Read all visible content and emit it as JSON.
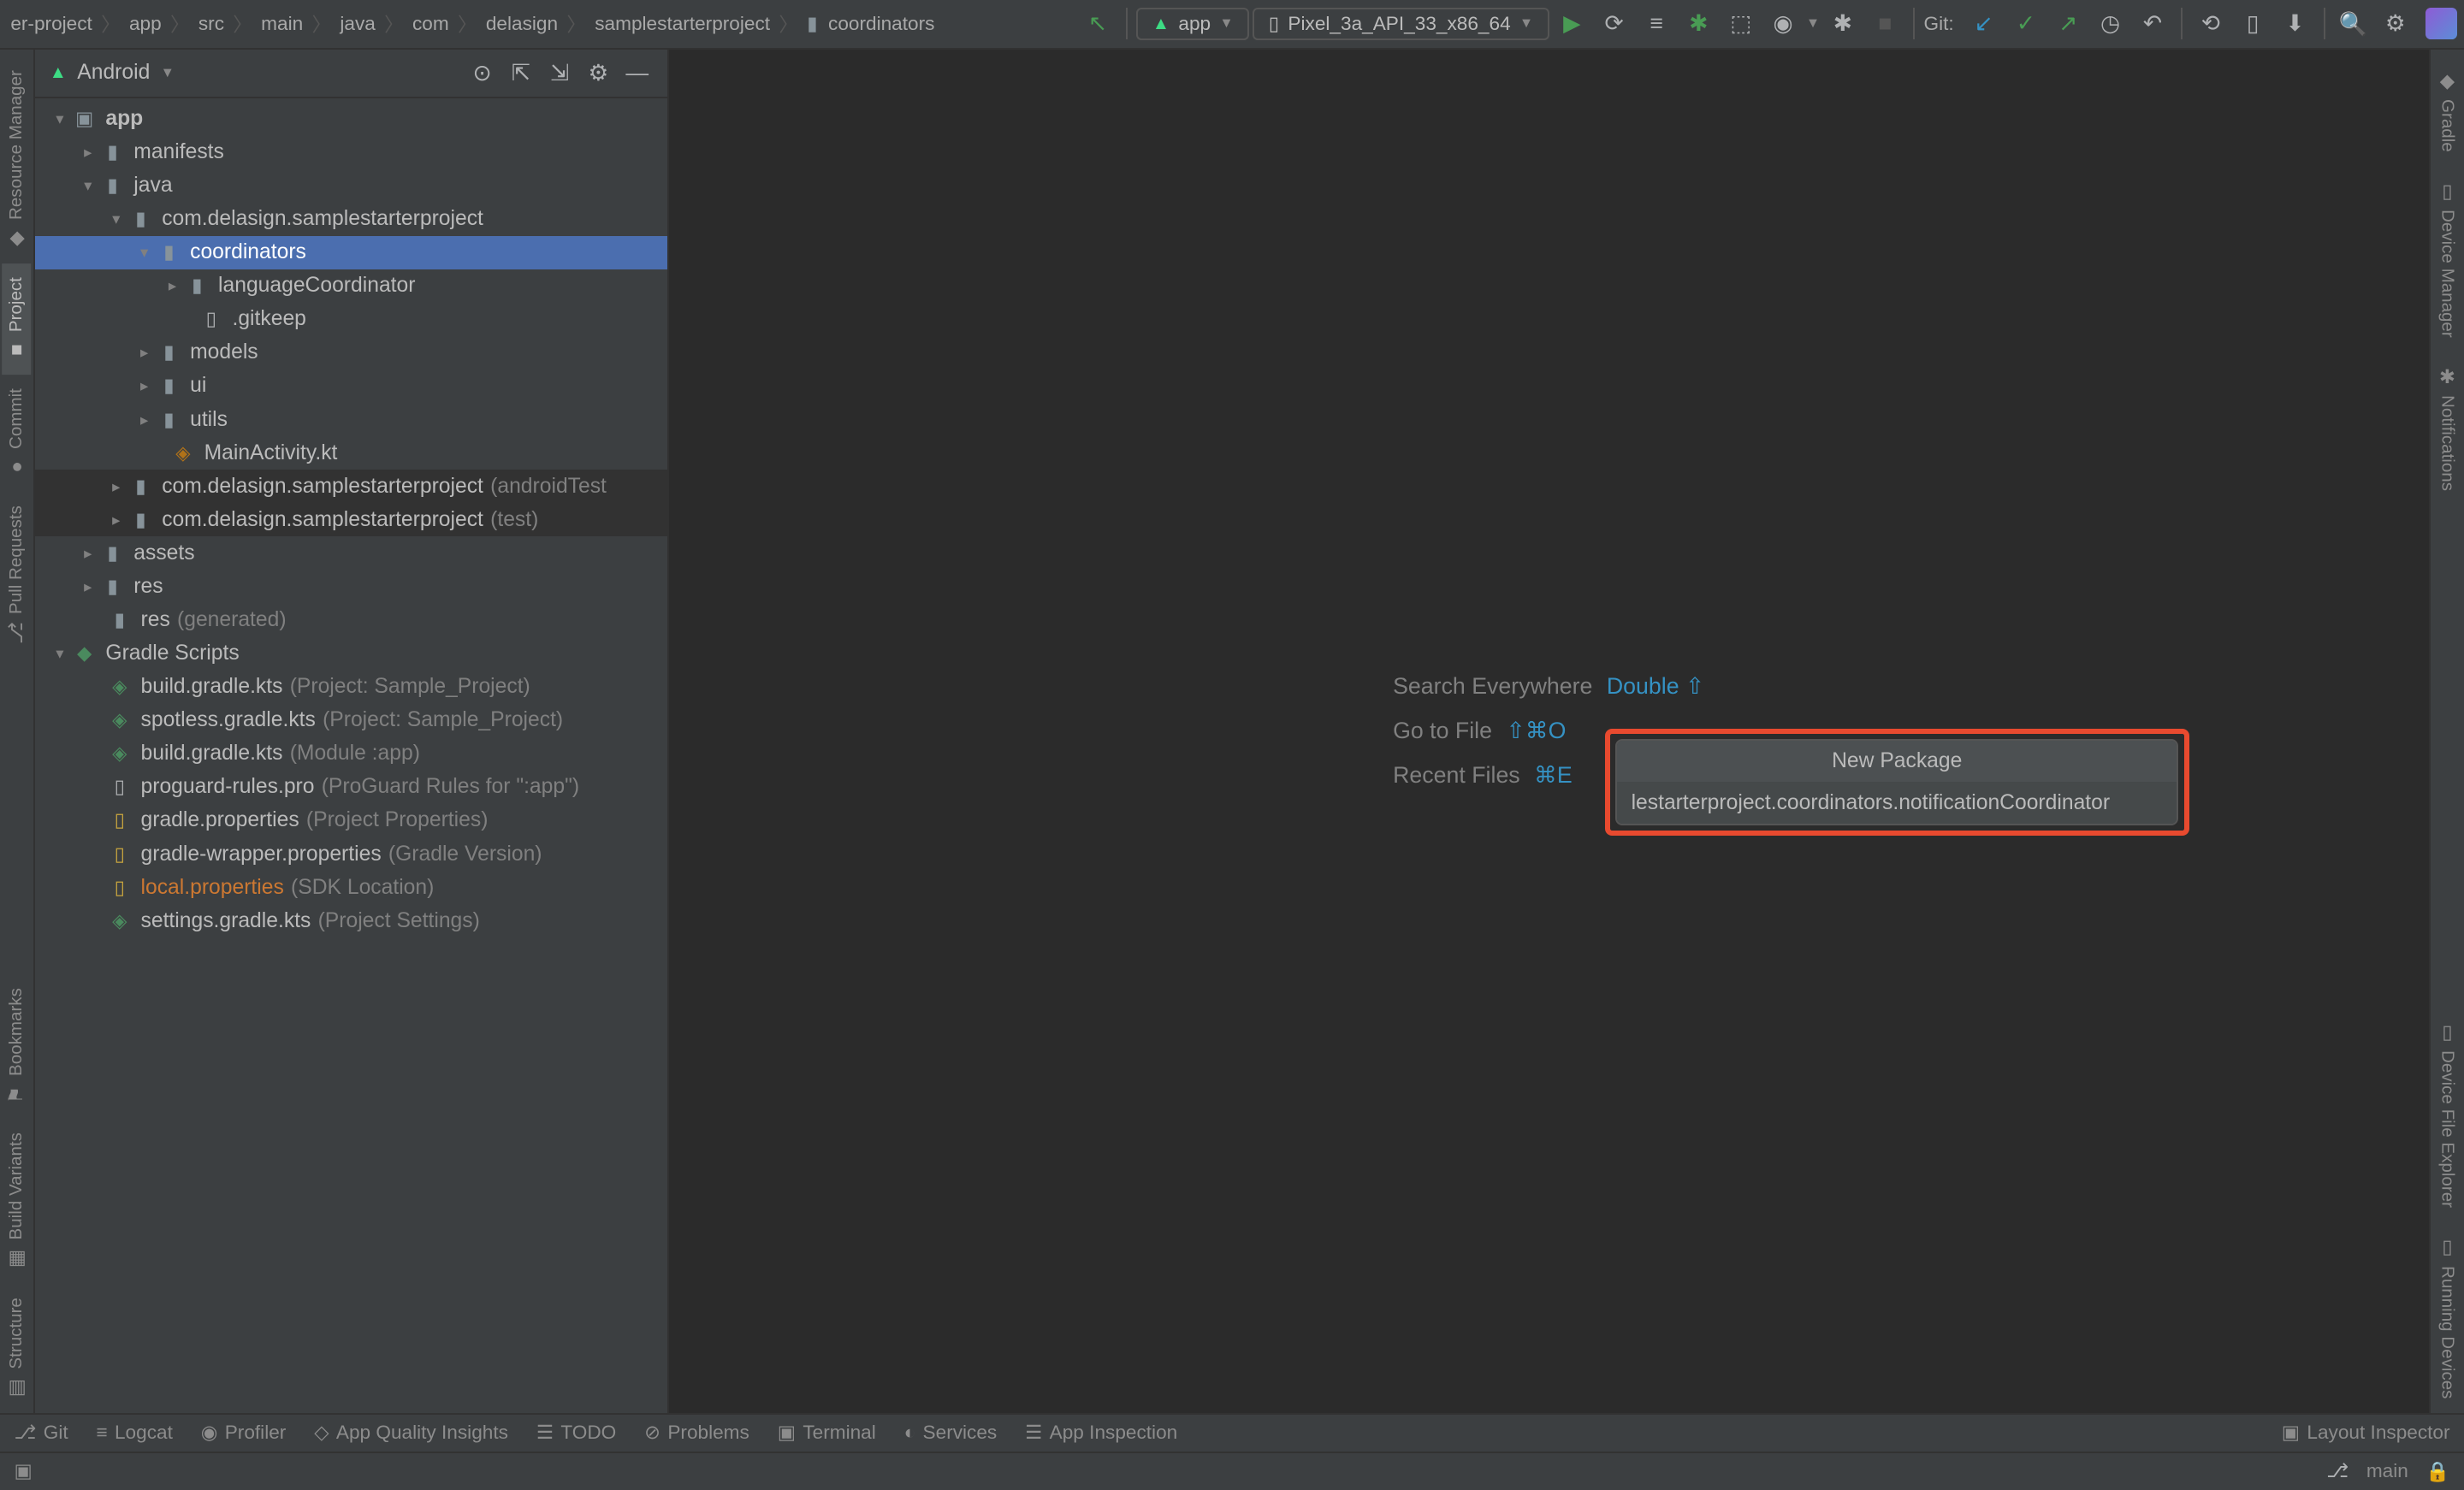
{
  "breadcrumb": [
    "er-project",
    "app",
    "src",
    "main",
    "java",
    "com",
    "delasign",
    "samplestarterproject",
    "coordinators"
  ],
  "runConfig": {
    "module": "app",
    "device": "Pixel_3a_API_33_x86_64"
  },
  "gitLabel": "Git:",
  "projectPanel": {
    "viewMode": "Android"
  },
  "tree": {
    "app": "app",
    "manifests": "manifests",
    "java": "java",
    "pkg1": "com.delasign.samplestarterproject",
    "coordinators": "coordinators",
    "languageCoordinator": "languageCoordinator",
    "gitkeep": ".gitkeep",
    "models": "models",
    "ui": "ui",
    "utils": "utils",
    "mainActivity": "MainActivity.kt",
    "pkg2": "com.delasign.samplestarterproject",
    "pkg2suffix": "(androidTest",
    "pkg3": "com.delasign.samplestarterproject",
    "pkg3suffix": "(test)",
    "assets": "assets",
    "res": "res",
    "resGen": "res",
    "resGenSuffix": "(generated)",
    "gradleScripts": "Gradle Scripts",
    "buildGradle1": "build.gradle.kts",
    "buildGradle1Suffix": "(Project: Sample_Project)",
    "spotless": "spotless.gradle.kts",
    "spotlessSuffix": "(Project: Sample_Project)",
    "buildGradle2": "build.gradle.kts",
    "buildGradle2Suffix": "(Module :app)",
    "proguard": "proguard-rules.pro",
    "proguardSuffix": "(ProGuard Rules for \":app\")",
    "gradleProps": "gradle.properties",
    "gradlePropsSuffix": "(Project Properties)",
    "gradleWrapper": "gradle-wrapper.properties",
    "gradleWrapperSuffix": "(Gradle Version)",
    "localProps": "local.properties",
    "localPropsSuffix": "(SDK Location)",
    "settings": "settings.gradle.kts",
    "settingsSuffix": "(Project Settings)"
  },
  "hints": {
    "searchEverywhere": "Search Everywhere",
    "searchShortcut": "Double ⇧",
    "goToFile": "Go to File",
    "goToFileShortcut": "⇧⌘O",
    "recentFiles": "Recent Files",
    "recentFilesShortcut": "⌘E"
  },
  "popup": {
    "title": "New Package",
    "value": "lestarterproject.coordinators.notificationCoordinator"
  },
  "leftSidebar": {
    "resourceManager": "Resource Manager",
    "project": "Project",
    "commit": "Commit",
    "pullRequests": "Pull Requests",
    "bookmarks": "Bookmarks",
    "buildVariants": "Build Variants",
    "structure": "Structure"
  },
  "rightSidebar": {
    "gradle": "Gradle",
    "deviceManager": "Device Manager",
    "notifications": "Notifications",
    "deviceFileExplorer": "Device File Explorer",
    "runningDevices": "Running Devices"
  },
  "bottomBar": {
    "git": "Git",
    "logcat": "Logcat",
    "profiler": "Profiler",
    "appQuality": "App Quality Insights",
    "todo": "TODO",
    "problems": "Problems",
    "terminal": "Terminal",
    "services": "Services",
    "appInspection": "App Inspection",
    "layoutInspector": "Layout Inspector"
  },
  "statusBar": {
    "branch": "main"
  }
}
